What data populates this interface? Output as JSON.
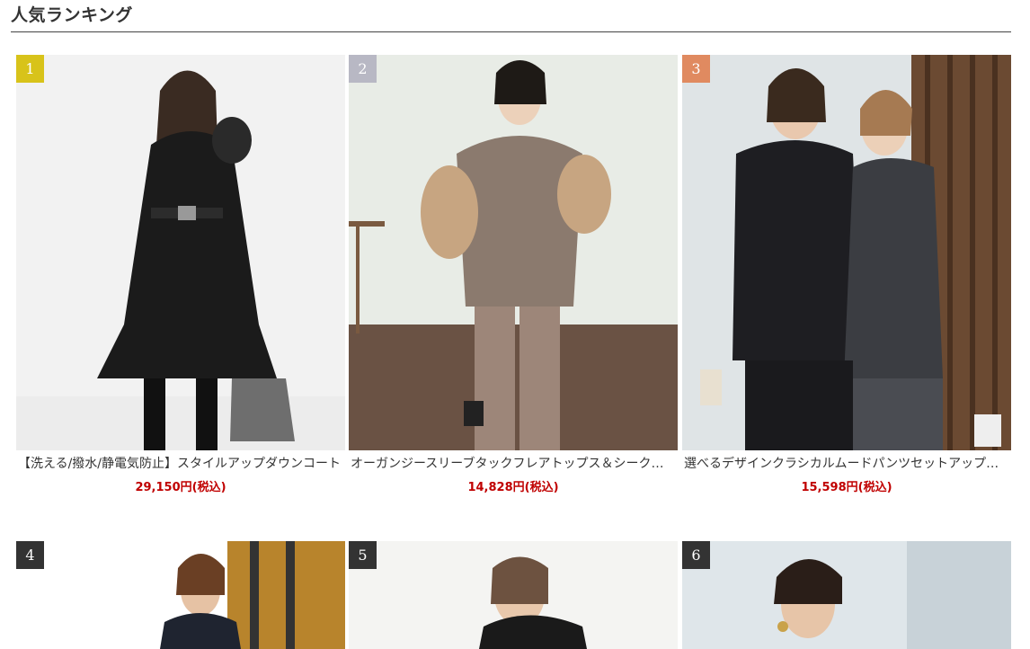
{
  "section": {
    "title": "人気ランキング"
  },
  "rank_colors": {
    "1": "#d8c31a",
    "2": "#b8b8c4",
    "3": "#e08a60",
    "other": "#333333"
  },
  "products": [
    {
      "rank": "1",
      "name": "【洗える/撥水/静電気防止】スタイルアップダウンコート",
      "price": "29,150円(税込)"
    },
    {
      "rank": "2",
      "name": "オーガンジースリーブタックフレアトップス＆シークレットストレッチパンツセット",
      "price": "14,828円(税込)"
    },
    {
      "rank": "3",
      "name": "選べるデザインクラシカルムードパンツセットアップ「P...",
      "price": "15,598円(税込)"
    },
    {
      "rank": "4",
      "name": "",
      "price": ""
    },
    {
      "rank": "5",
      "name": "",
      "price": ""
    },
    {
      "rank": "6",
      "name": "",
      "price": ""
    }
  ]
}
